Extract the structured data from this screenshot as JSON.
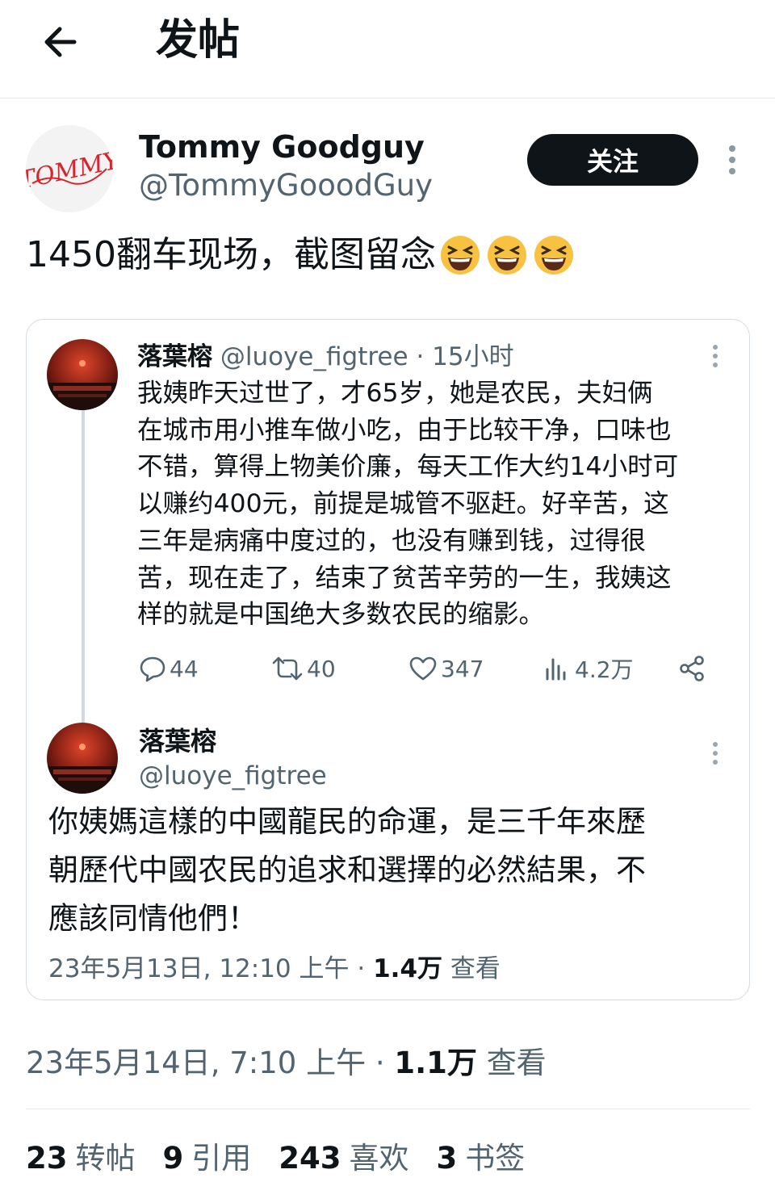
{
  "header": {
    "title": "发帖"
  },
  "post": {
    "author_name": "Tommy Goodguy",
    "author_handle": "@TommyGooodGuy",
    "avatar_text": "TOMMY",
    "follow_label": "关注",
    "text": "1450翻车现场，截图留念",
    "date": "23年5月14日, 7:10 上午",
    "sep": "·",
    "views": "1.1万",
    "views_label": "查看"
  },
  "quote_original": {
    "name": "落葉榕",
    "handle": "@luoye_figtree",
    "time": "15小时",
    "sep": "·",
    "lines": [
      "我姨昨天过世了，才65岁，她是农民，夫妇俩",
      "在城市用小推车做小吃，由于比较干净，口味也",
      "不错，算得上物美价廉，每天工作大约14小时可",
      "以赚约400元，前提是城管不驱赶。好辛苦，这",
      "三年是病痛中度过的，也没有赚到钱，过得很",
      "苦，现在走了，结束了贫苦辛劳的一生，我姨这",
      "样的就是中国绝大多数农民的缩影。"
    ],
    "actions": {
      "replies": "44",
      "retweets": "40",
      "likes": "347",
      "views": "4.2万"
    }
  },
  "quote_reply": {
    "name": "落葉榕",
    "handle": "@luoye_figtree",
    "lines": [
      "你姨媽這樣的中國龍民的命運，是三千年來歷",
      "朝歷代中國农民的追求和選擇的必然結果，不",
      "應該同情他們！"
    ],
    "date": "23年5月13日, 12:10 上午",
    "sep": "·",
    "views": "1.4万",
    "views_label": "查看"
  },
  "stats": [
    {
      "count": "23",
      "label": "转帖"
    },
    {
      "count": "9",
      "label": "引用"
    },
    {
      "count": "243",
      "label": "喜欢"
    },
    {
      "count": "3",
      "label": "书签"
    }
  ],
  "colors": {
    "text": "#0f1419",
    "muted": "#536471",
    "border": "#d6dbdf",
    "avatar_script": "#d8242c"
  },
  "icons": [
    "back-arrow-icon",
    "more-vertical-icon",
    "reply-icon",
    "retweet-icon",
    "like-icon",
    "views-icon",
    "share-icon",
    "laughing-emoji-icon"
  ]
}
